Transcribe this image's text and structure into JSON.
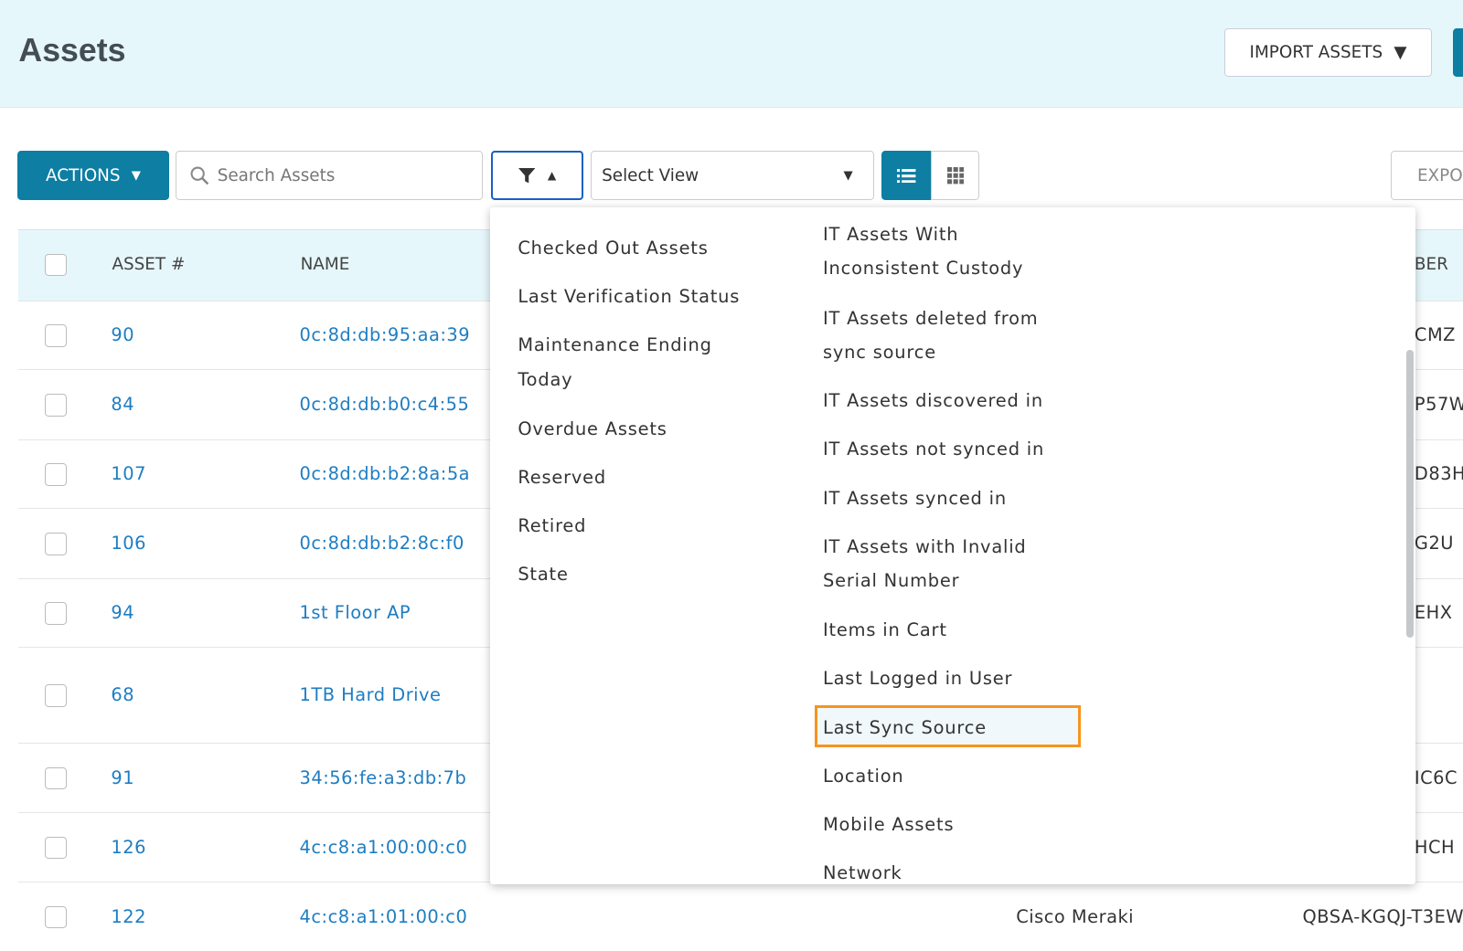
{
  "header": {
    "title": "Assets",
    "import_label": "IMPORT ASSETS"
  },
  "toolbar": {
    "actions_label": "ACTIONS",
    "search_placeholder": "Search Assets",
    "view_select": "Select View",
    "export_label": "EXPO"
  },
  "table": {
    "columns": [
      "ASSET #",
      "NAME",
      "BER"
    ],
    "rows": [
      {
        "num": "90",
        "name": "0c:8d:db:95:aa:39",
        "serial": "CMZ"
      },
      {
        "num": "84",
        "name": "0c:8d:db:b0:c4:55",
        "serial": "P57W"
      },
      {
        "num": "107",
        "name": "0c:8d:db:b2:8a:5a",
        "serial": "D83H"
      },
      {
        "num": "106",
        "name": "0c:8d:db:b2:8c:f0",
        "serial": "G2U"
      },
      {
        "num": "94",
        "name": "1st Floor AP",
        "serial": "EHX"
      },
      {
        "num": "68",
        "name": "1TB Hard Drive",
        "serial": ""
      },
      {
        "num": "91",
        "name": "34:56:fe:a3:db:7b",
        "serial": "IC6C"
      },
      {
        "num": "126",
        "name": "4c:c8:a1:00:00:c0",
        "serial": "HCH"
      },
      {
        "num": "122",
        "name": "4c:c8:a1:01:00:c0",
        "manufacturer": "Cisco Meraki",
        "serial": "QBSA-KGQJ-T3EW"
      }
    ]
  },
  "filter_menu": {
    "left": [
      "Checked Out Assets",
      "Last Verification Status",
      "Maintenance Ending\nToday",
      "Overdue Assets",
      "Reserved",
      "Retired",
      "State"
    ],
    "right": [
      "IT Assets With\nInconsistent Custody",
      "IT Assets deleted from\nsync source",
      "IT Assets discovered in",
      "IT Assets not synced in",
      "IT Assets synced in",
      "IT Assets with Invalid\nSerial Number",
      "Items in Cart",
      "Last Logged in User",
      "Last Sync Source",
      "Location",
      "Mobile Assets",
      "Network"
    ],
    "highlighted": "Last Sync Source",
    "highlight_color": "#f7941d"
  },
  "colors": {
    "primary": "#0e7ea3",
    "link": "#1d7dc2",
    "header_bg": "#e6f7fb"
  }
}
